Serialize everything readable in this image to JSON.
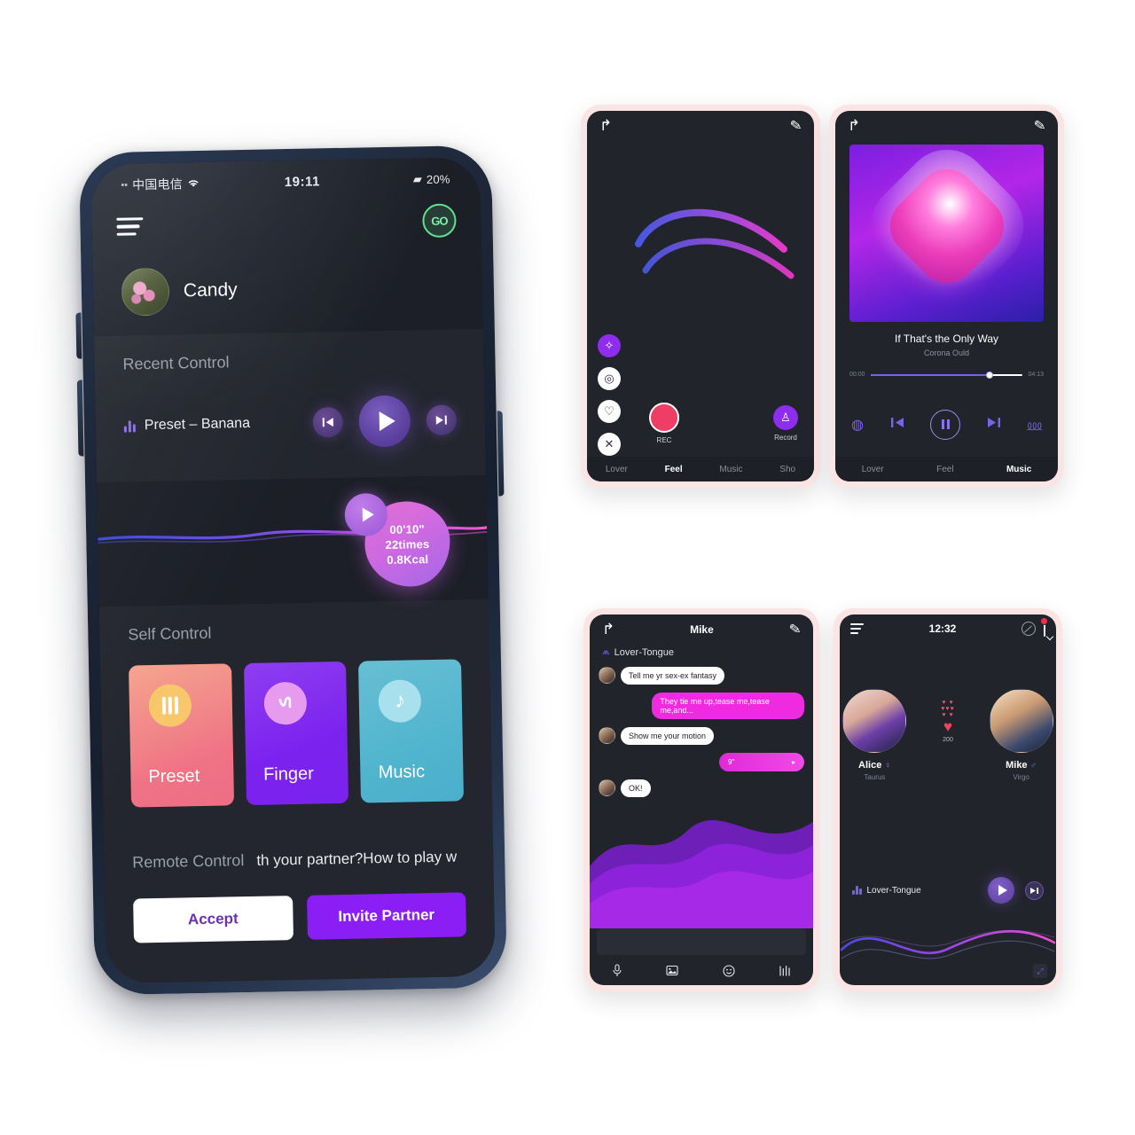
{
  "main_phone": {
    "status_bar": {
      "carrier": "中国电信",
      "wifi_icon": "wifi-icon",
      "time": "19:11",
      "battery": "20%"
    },
    "app_bar": {
      "menu_icon": "hamburger-menu-icon",
      "go_label": "GO"
    },
    "profile": {
      "name": "Candy",
      "avatar_icon": "user-avatar"
    },
    "recent_control": {
      "title": "Recent Control",
      "track": "Preset – Banana",
      "eq_icon": "equalizer-icon",
      "prev_icon": "◀◀",
      "play_icon": "play-icon",
      "next_icon": "▶▶"
    },
    "stats_bubble": {
      "play_icon": "play-icon",
      "duration": "00'10\"",
      "times": "22times",
      "calories": "0.8Kcal"
    },
    "self_control": {
      "title": "Self Control",
      "tiles": [
        {
          "label": "Preset",
          "icon": "sliders-icon",
          "color": "#ef7285"
        },
        {
          "label": "Finger",
          "icon": "wave-gesture-icon",
          "color": "#7c22ef"
        },
        {
          "label": "Music",
          "icon": "music-note-icon",
          "color": "#4fb3cd"
        }
      ]
    },
    "remote_control": {
      "title": "Remote Control",
      "subtitle": "th your partner?How to play w",
      "accept_label": "Accept",
      "invite_label": "Invite Partner"
    }
  },
  "phone_feel": {
    "back_icon": "back-arrow-icon",
    "edit_icon": "pen-icon",
    "side_buttons": [
      {
        "icon": "star-icon",
        "glyph": "✧",
        "active": true
      },
      {
        "icon": "spiral-icon",
        "glyph": "◎",
        "active": false
      },
      {
        "icon": "heart-icon",
        "glyph": "♡",
        "active": false
      },
      {
        "icon": "close-icon",
        "glyph": "✕",
        "active": false
      }
    ],
    "record_button": {
      "label": "REC",
      "icon": "record-dot-icon"
    },
    "record_save": {
      "label": "Record",
      "icon": "save-record-icon"
    },
    "tabs": [
      {
        "label": "Lover",
        "active": false
      },
      {
        "label": "Feel",
        "active": true
      },
      {
        "label": "Music",
        "active": false
      },
      {
        "label": "Sho",
        "active": false
      }
    ]
  },
  "phone_music": {
    "back_icon": "back-arrow-icon",
    "edit_icon": "pen-icon",
    "artwork_icon": "album-art-blob",
    "title": "If That's the Only Way",
    "artist": "Corona Ould",
    "time_elapsed": "00:00",
    "time_total": "04:13",
    "controls": {
      "repeat_icon": "repeat-icon",
      "prev_icon": "previous-track-icon",
      "pause_icon": "pause-icon",
      "next_icon": "next-track-icon",
      "playlist_icon": "playlist-icon"
    },
    "tabs": [
      {
        "label": "Lover",
        "active": false
      },
      {
        "label": "Feel",
        "active": false
      },
      {
        "label": "Music",
        "active": true
      }
    ]
  },
  "phone_chat": {
    "back_icon": "back-arrow-icon",
    "edit_icon": "pen-icon",
    "title": "Mike",
    "device_label": "Lover-Tongue",
    "device_icon": "device-icon",
    "messages": [
      {
        "from": "them",
        "text": "Tell me yr sex-ex fantasy",
        "type": "text"
      },
      {
        "from": "me",
        "text": "They tie me up,tease me,tease me,and...",
        "type": "text"
      },
      {
        "from": "them",
        "text": "Show me your motion",
        "type": "text"
      },
      {
        "from": "me",
        "text": "9\"",
        "type": "voice"
      },
      {
        "from": "them",
        "text": "OK!",
        "type": "text"
      }
    ],
    "input_placeholder": "",
    "tools": [
      {
        "icon": "microphone-icon",
        "glyph": "🎤"
      },
      {
        "icon": "image-icon",
        "glyph": "🖼"
      },
      {
        "icon": "emoji-icon",
        "glyph": "☺"
      },
      {
        "icon": "vibration-pattern-icon",
        "glyph": "⦀"
      }
    ]
  },
  "phone_lovers": {
    "menu_icon": "hamburger-menu-icon",
    "time": "12:32",
    "block_icon": "no-entry-icon",
    "chat_icon": "chat-bubble-icon",
    "badge_icon": "notification-badge",
    "left_person": {
      "name": "Alice",
      "gender_icon": "female-icon",
      "gender_glyph": "♀",
      "sign": "Taurus",
      "avatar_icon": "avatar-alice"
    },
    "right_person": {
      "name": "Mike",
      "gender_icon": "male-icon",
      "gender_glyph": "♂",
      "sign": "Virgo",
      "avatar_icon": "avatar-mike"
    },
    "hearts": {
      "icon": "heart-icon",
      "count": "200"
    },
    "player": {
      "track": "Lover-Tongue",
      "eq_icon": "equalizer-icon",
      "play_icon": "play-icon",
      "next_icon": "next-track-icon"
    },
    "expand_icon": "expand-icon"
  }
}
